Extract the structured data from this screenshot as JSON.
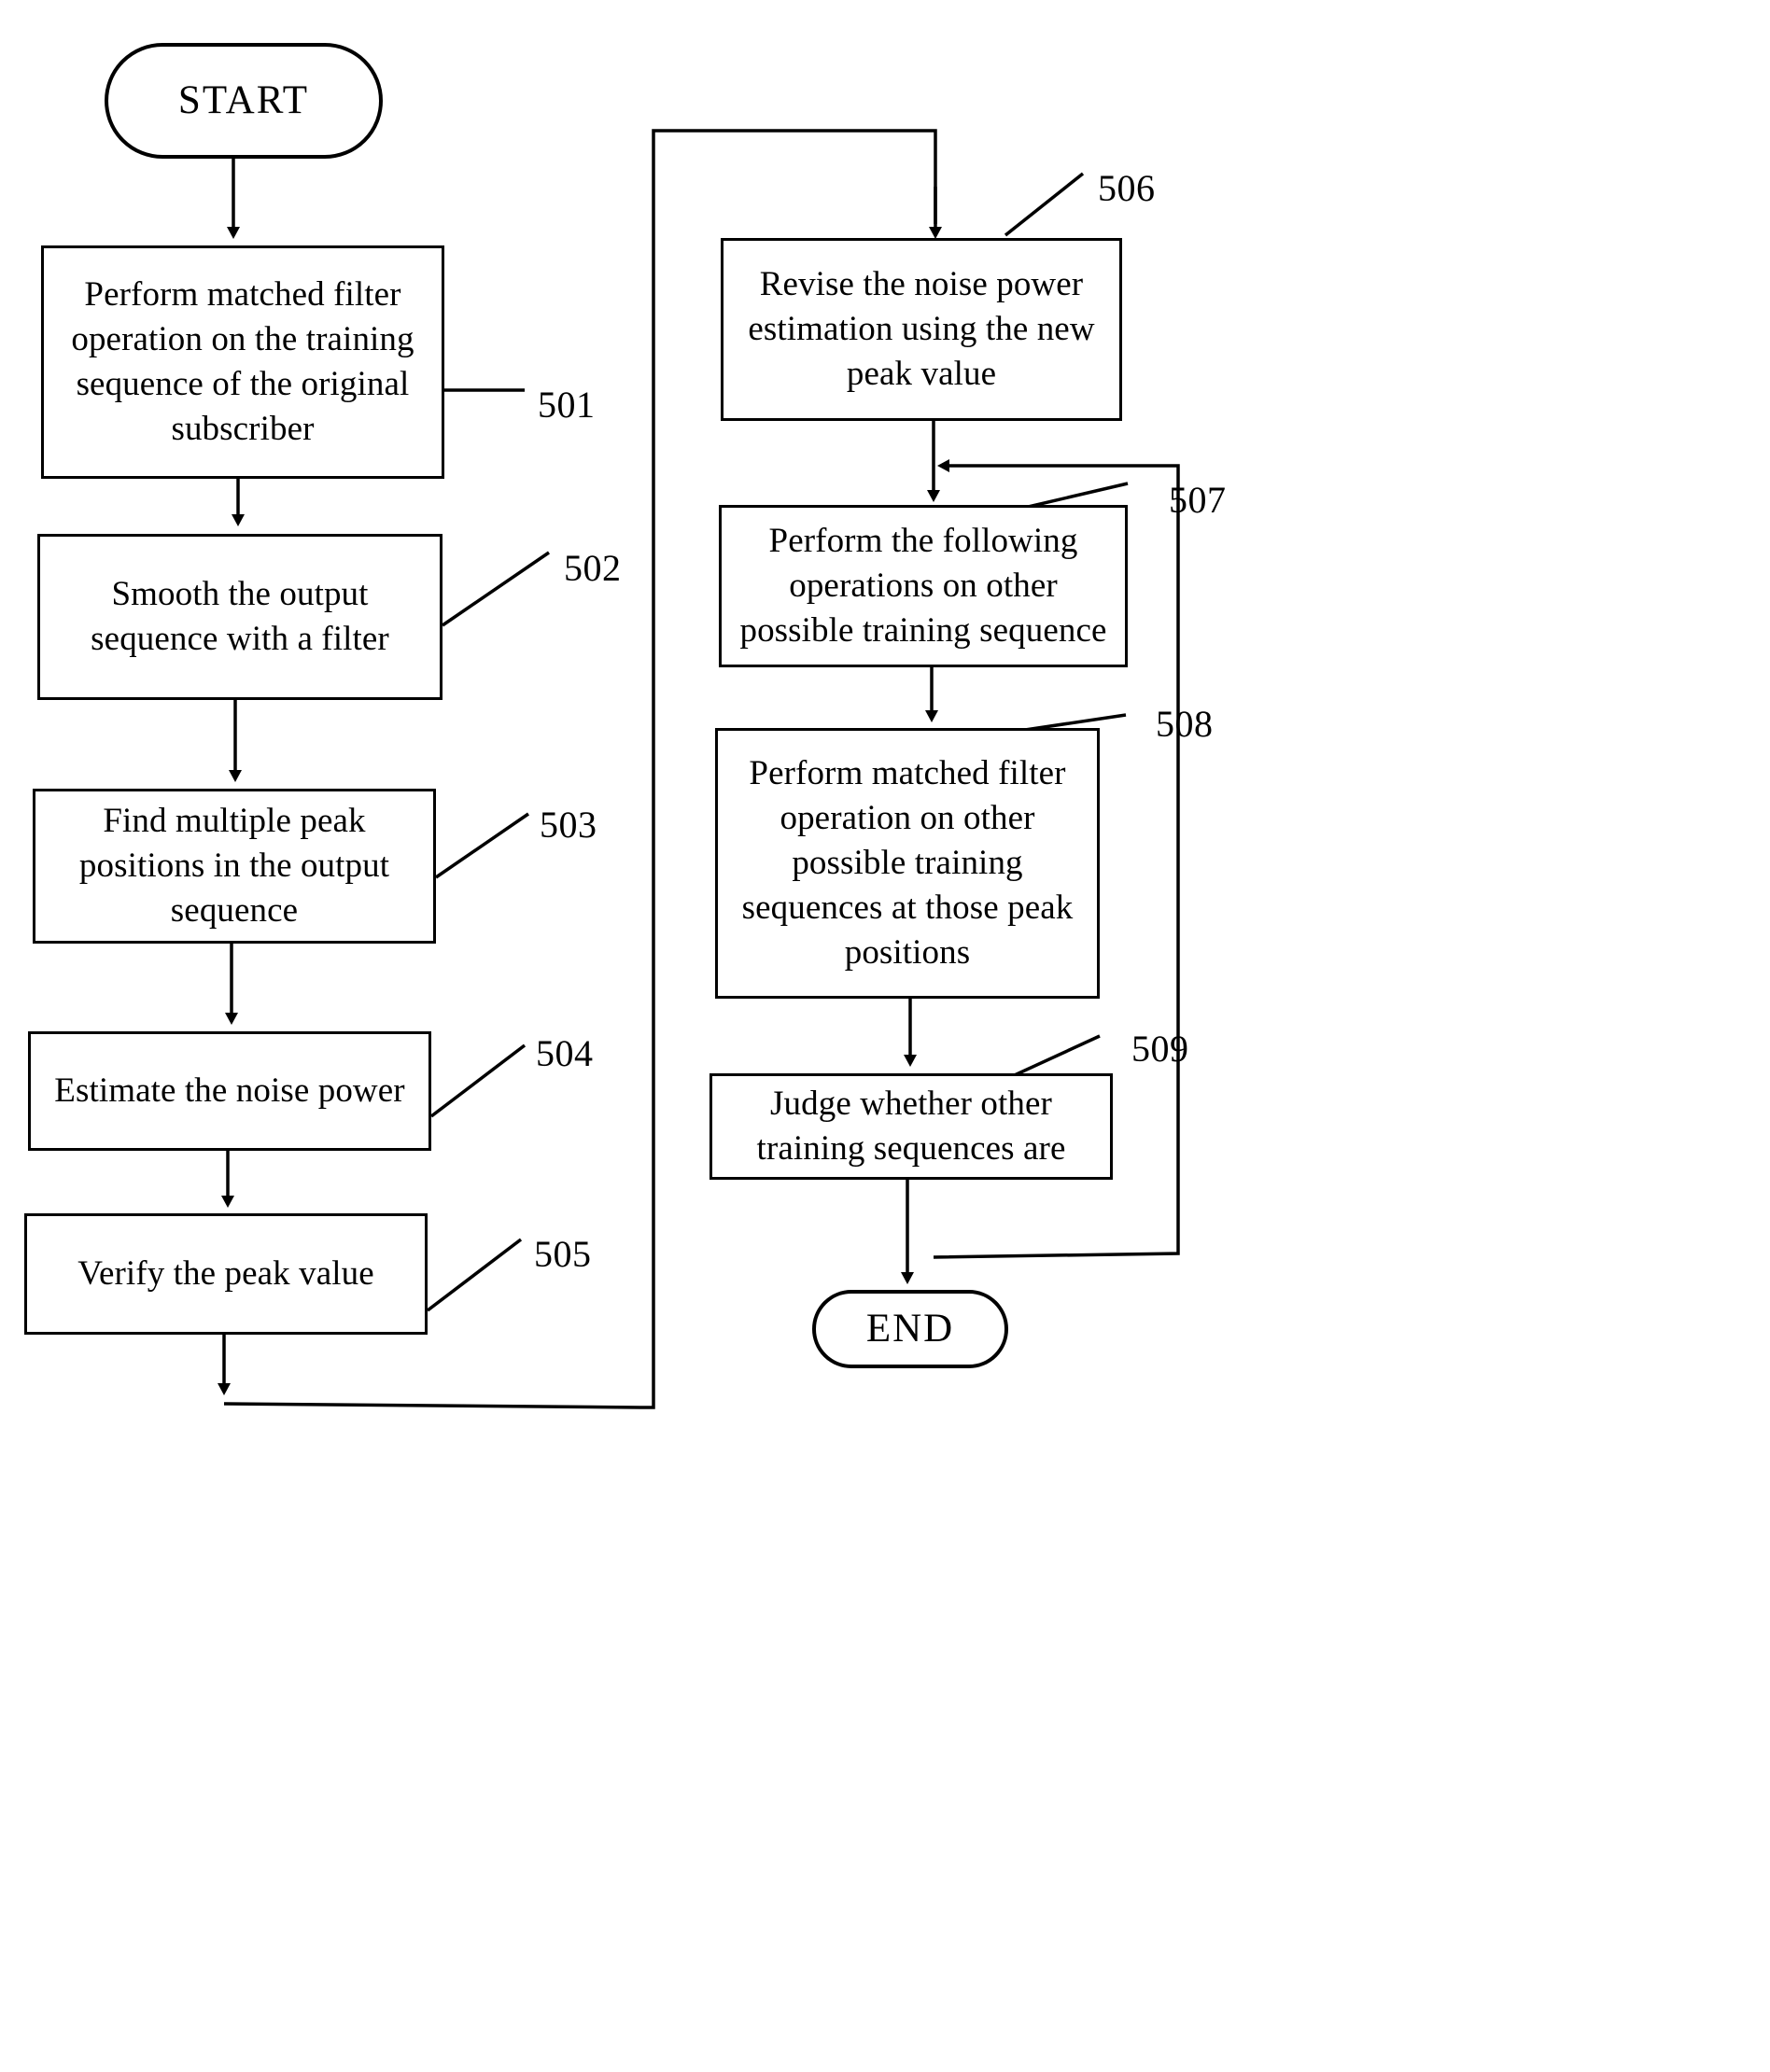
{
  "diagram": {
    "type": "flowchart",
    "title": "",
    "orientation": "two-column",
    "nodes": [
      {
        "id": "start",
        "shape": "terminator",
        "label": "START"
      },
      {
        "id": "501",
        "shape": "process",
        "label": "Perform matched filter operation on the training sequence of the original subscriber",
        "ref": "501"
      },
      {
        "id": "502",
        "shape": "process",
        "label": "Smooth the output sequence with a filter",
        "ref": "502"
      },
      {
        "id": "503",
        "shape": "process",
        "label": "Find multiple peak positions in the output sequence",
        "ref": "503"
      },
      {
        "id": "504",
        "shape": "process",
        "label": "Estimate the noise power",
        "ref": "504"
      },
      {
        "id": "505",
        "shape": "process",
        "label": "Verify the peak value",
        "ref": "505"
      },
      {
        "id": "506",
        "shape": "process",
        "label": "Revise the noise power estimation using the new peak value",
        "ref": "506"
      },
      {
        "id": "507",
        "shape": "process",
        "label": "Perform the following operations on other possible training sequence",
        "ref": "507"
      },
      {
        "id": "508",
        "shape": "process",
        "label": "Perform matched filter operation on other possible training sequences at those peak positions",
        "ref": "508"
      },
      {
        "id": "509",
        "shape": "process",
        "label": "Judge whether other training sequences are",
        "ref": "509"
      },
      {
        "id": "end",
        "shape": "terminator",
        "label": "END"
      }
    ],
    "edges": [
      {
        "from": "start",
        "to": "501"
      },
      {
        "from": "501",
        "to": "502"
      },
      {
        "from": "502",
        "to": "503"
      },
      {
        "from": "503",
        "to": "504"
      },
      {
        "from": "504",
        "to": "505"
      },
      {
        "from": "505",
        "to": "506",
        "style": "loop-around-left"
      },
      {
        "from": "506",
        "to": "507"
      },
      {
        "from": "507",
        "to": "508"
      },
      {
        "from": "508",
        "to": "509"
      },
      {
        "from": "509",
        "to": "end"
      },
      {
        "from": "509",
        "to": "507",
        "style": "feedback-right"
      }
    ],
    "reference_numerals": [
      "501",
      "502",
      "503",
      "504",
      "505",
      "506",
      "507",
      "508",
      "509"
    ],
    "colors": {
      "stroke": "#000000",
      "fill": "#ffffff",
      "text": "#000000"
    }
  }
}
